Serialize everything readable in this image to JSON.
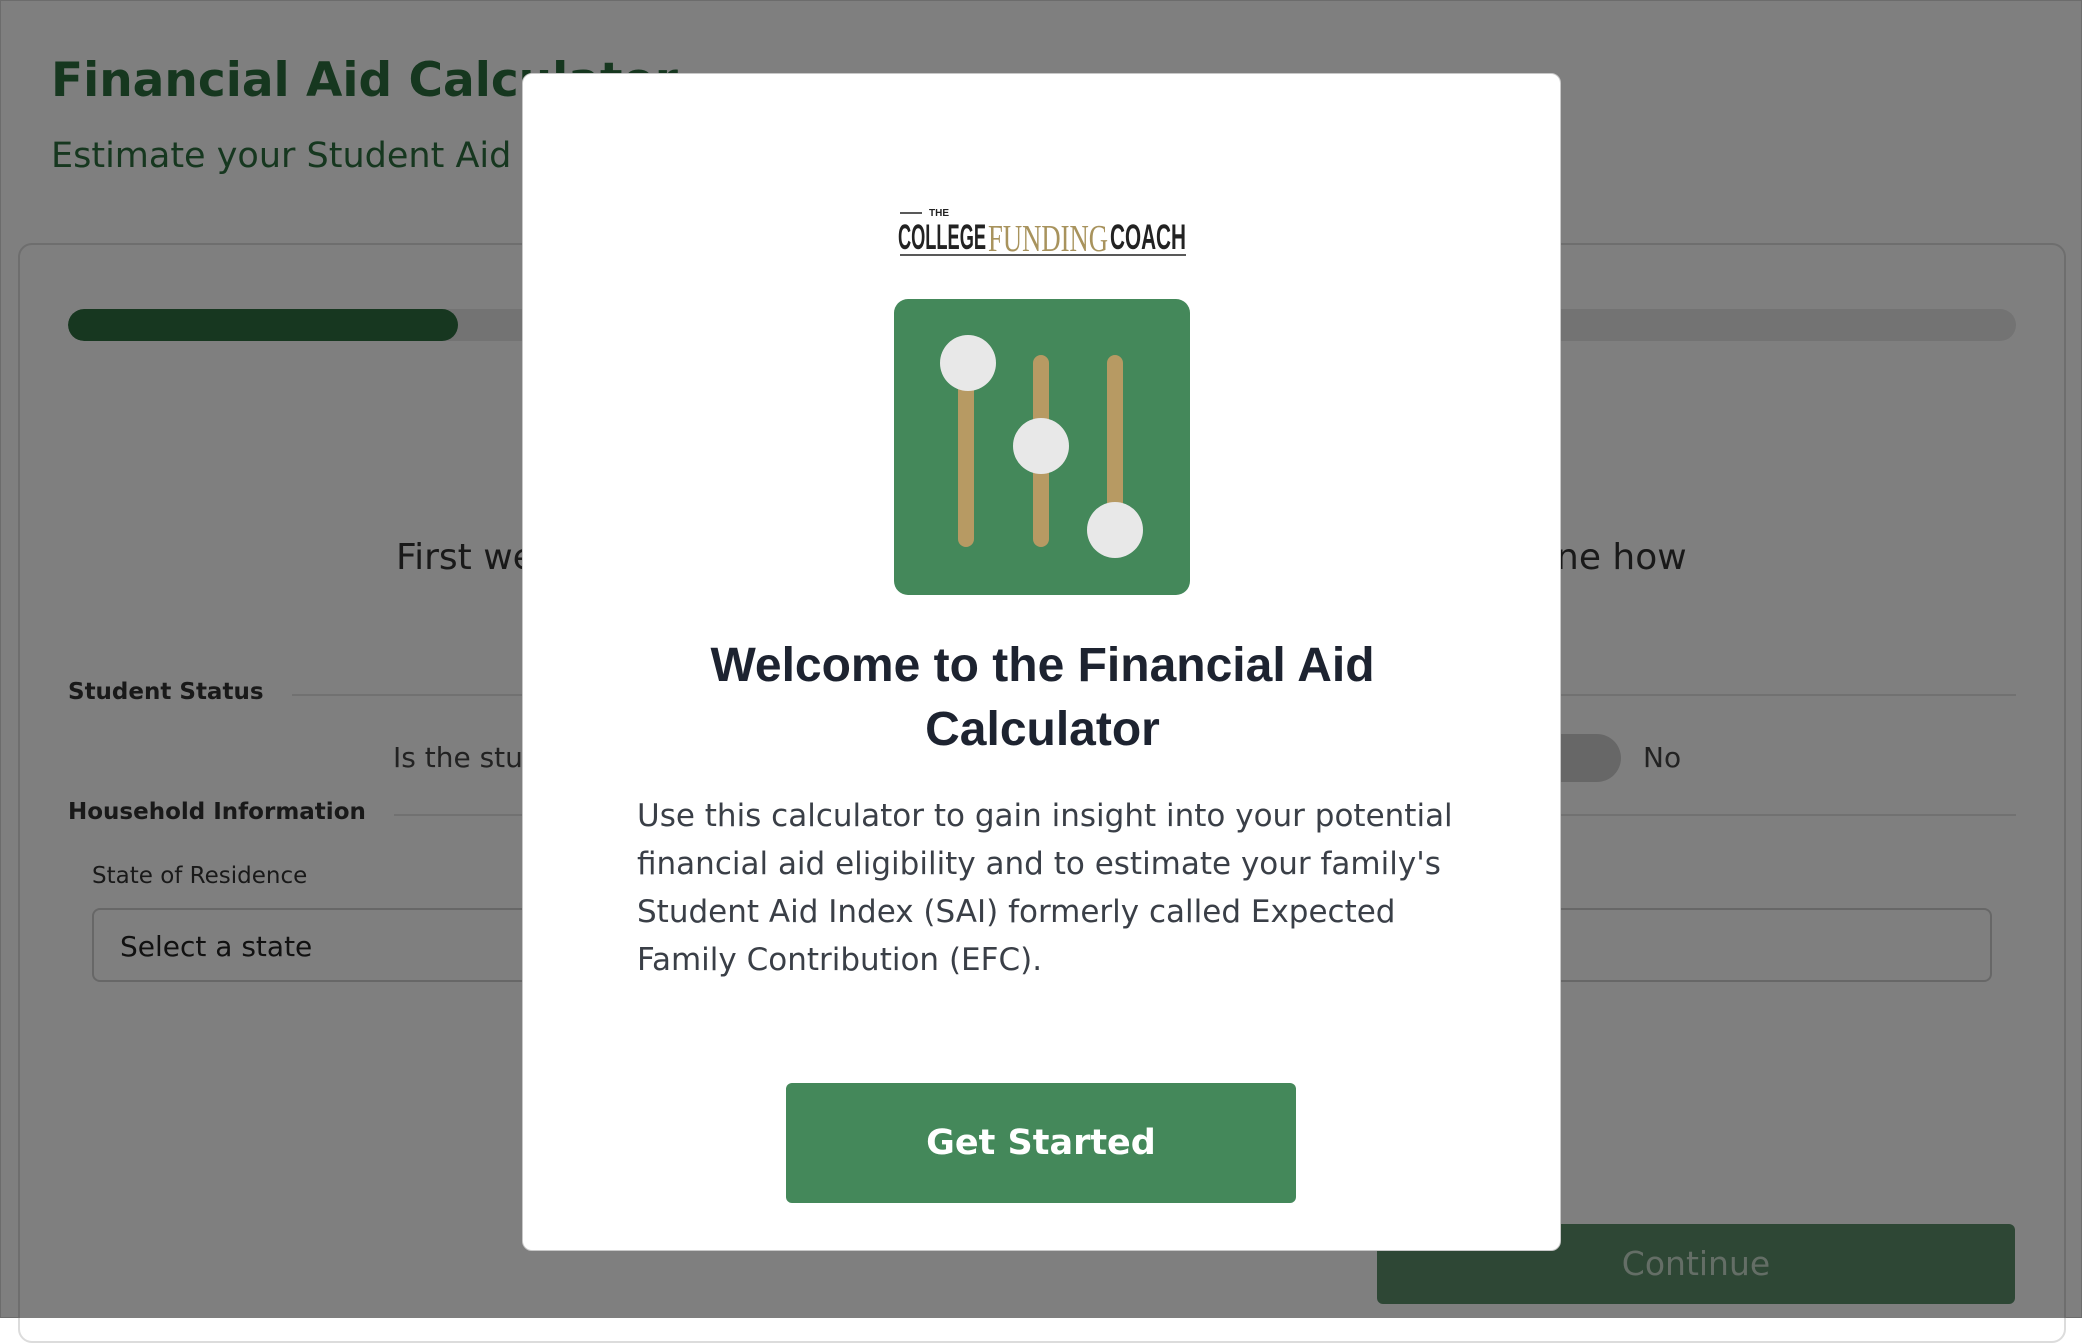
{
  "page": {
    "title": "Financial Aid Calculator",
    "subtitle": "Estimate your Student Aid Index",
    "progress_fraction": 0.2
  },
  "form": {
    "intro_text_start": "First we",
    "intro_text_end": "ine how",
    "student_status_label": "Student Status",
    "question_text": "Is the stud",
    "toggle_no_label": "No",
    "household_label": "Household Information",
    "state_label": "State of Residence",
    "state_value": "Select a state",
    "continue_label": "Continue"
  },
  "modal": {
    "logo": {
      "the": "THE",
      "college": "COLLEGE",
      "funding": "FUNDING",
      "coach": "COACH"
    },
    "icon_name": "sliders-icon",
    "title": "Welcome to the Financial Aid Calculator",
    "body": "Use this calculator to gain insight into your potential financial aid eligibility and to estimate your family's Student Aid Index (SAI) formerly called Expected Family Contribution (EFC).",
    "cta_label": "Get Started"
  },
  "colors": {
    "brand_green": "#2c6e3f",
    "button_green": "#44885a",
    "icon_bg": "#44885a",
    "slider_track": "#b79a63",
    "slider_knob": "#e8e8e8",
    "logo_gold": "#a8935d"
  }
}
